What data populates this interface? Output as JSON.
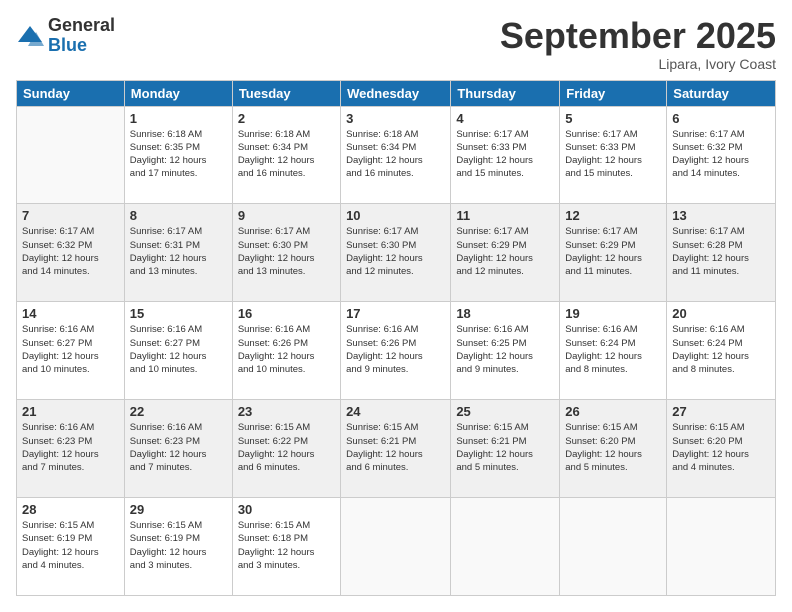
{
  "logo": {
    "general": "General",
    "blue": "Blue"
  },
  "header": {
    "month": "September 2025",
    "location": "Lipara, Ivory Coast"
  },
  "weekdays": [
    "Sunday",
    "Monday",
    "Tuesday",
    "Wednesday",
    "Thursday",
    "Friday",
    "Saturday"
  ],
  "weeks": [
    [
      {
        "day": "",
        "info": ""
      },
      {
        "day": "1",
        "info": "Sunrise: 6:18 AM\nSunset: 6:35 PM\nDaylight: 12 hours\nand 17 minutes."
      },
      {
        "day": "2",
        "info": "Sunrise: 6:18 AM\nSunset: 6:34 PM\nDaylight: 12 hours\nand 16 minutes."
      },
      {
        "day": "3",
        "info": "Sunrise: 6:18 AM\nSunset: 6:34 PM\nDaylight: 12 hours\nand 16 minutes."
      },
      {
        "day": "4",
        "info": "Sunrise: 6:17 AM\nSunset: 6:33 PM\nDaylight: 12 hours\nand 15 minutes."
      },
      {
        "day": "5",
        "info": "Sunrise: 6:17 AM\nSunset: 6:33 PM\nDaylight: 12 hours\nand 15 minutes."
      },
      {
        "day": "6",
        "info": "Sunrise: 6:17 AM\nSunset: 6:32 PM\nDaylight: 12 hours\nand 14 minutes."
      }
    ],
    [
      {
        "day": "7",
        "info": "Sunrise: 6:17 AM\nSunset: 6:32 PM\nDaylight: 12 hours\nand 14 minutes."
      },
      {
        "day": "8",
        "info": "Sunrise: 6:17 AM\nSunset: 6:31 PM\nDaylight: 12 hours\nand 13 minutes."
      },
      {
        "day": "9",
        "info": "Sunrise: 6:17 AM\nSunset: 6:30 PM\nDaylight: 12 hours\nand 13 minutes."
      },
      {
        "day": "10",
        "info": "Sunrise: 6:17 AM\nSunset: 6:30 PM\nDaylight: 12 hours\nand 12 minutes."
      },
      {
        "day": "11",
        "info": "Sunrise: 6:17 AM\nSunset: 6:29 PM\nDaylight: 12 hours\nand 12 minutes."
      },
      {
        "day": "12",
        "info": "Sunrise: 6:17 AM\nSunset: 6:29 PM\nDaylight: 12 hours\nand 11 minutes."
      },
      {
        "day": "13",
        "info": "Sunrise: 6:17 AM\nSunset: 6:28 PM\nDaylight: 12 hours\nand 11 minutes."
      }
    ],
    [
      {
        "day": "14",
        "info": "Sunrise: 6:16 AM\nSunset: 6:27 PM\nDaylight: 12 hours\nand 10 minutes."
      },
      {
        "day": "15",
        "info": "Sunrise: 6:16 AM\nSunset: 6:27 PM\nDaylight: 12 hours\nand 10 minutes."
      },
      {
        "day": "16",
        "info": "Sunrise: 6:16 AM\nSunset: 6:26 PM\nDaylight: 12 hours\nand 10 minutes."
      },
      {
        "day": "17",
        "info": "Sunrise: 6:16 AM\nSunset: 6:26 PM\nDaylight: 12 hours\nand 9 minutes."
      },
      {
        "day": "18",
        "info": "Sunrise: 6:16 AM\nSunset: 6:25 PM\nDaylight: 12 hours\nand 9 minutes."
      },
      {
        "day": "19",
        "info": "Sunrise: 6:16 AM\nSunset: 6:24 PM\nDaylight: 12 hours\nand 8 minutes."
      },
      {
        "day": "20",
        "info": "Sunrise: 6:16 AM\nSunset: 6:24 PM\nDaylight: 12 hours\nand 8 minutes."
      }
    ],
    [
      {
        "day": "21",
        "info": "Sunrise: 6:16 AM\nSunset: 6:23 PM\nDaylight: 12 hours\nand 7 minutes."
      },
      {
        "day": "22",
        "info": "Sunrise: 6:16 AM\nSunset: 6:23 PM\nDaylight: 12 hours\nand 7 minutes."
      },
      {
        "day": "23",
        "info": "Sunrise: 6:15 AM\nSunset: 6:22 PM\nDaylight: 12 hours\nand 6 minutes."
      },
      {
        "day": "24",
        "info": "Sunrise: 6:15 AM\nSunset: 6:21 PM\nDaylight: 12 hours\nand 6 minutes."
      },
      {
        "day": "25",
        "info": "Sunrise: 6:15 AM\nSunset: 6:21 PM\nDaylight: 12 hours\nand 5 minutes."
      },
      {
        "day": "26",
        "info": "Sunrise: 6:15 AM\nSunset: 6:20 PM\nDaylight: 12 hours\nand 5 minutes."
      },
      {
        "day": "27",
        "info": "Sunrise: 6:15 AM\nSunset: 6:20 PM\nDaylight: 12 hours\nand 4 minutes."
      }
    ],
    [
      {
        "day": "28",
        "info": "Sunrise: 6:15 AM\nSunset: 6:19 PM\nDaylight: 12 hours\nand 4 minutes."
      },
      {
        "day": "29",
        "info": "Sunrise: 6:15 AM\nSunset: 6:19 PM\nDaylight: 12 hours\nand 3 minutes."
      },
      {
        "day": "30",
        "info": "Sunrise: 6:15 AM\nSunset: 6:18 PM\nDaylight: 12 hours\nand 3 minutes."
      },
      {
        "day": "",
        "info": ""
      },
      {
        "day": "",
        "info": ""
      },
      {
        "day": "",
        "info": ""
      },
      {
        "day": "",
        "info": ""
      }
    ]
  ]
}
